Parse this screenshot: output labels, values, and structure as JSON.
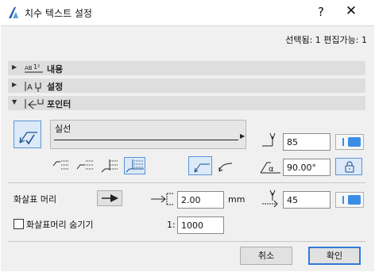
{
  "window": {
    "title": "치수 텍스트 설정",
    "help_label": "?",
    "close_label": "✕"
  },
  "selection_info": "선택됨: 1 편집가능: 1",
  "sections": [
    {
      "label": "내용",
      "expanded": false,
      "icon": "text-content-icon"
    },
    {
      "label": "설정",
      "expanded": false,
      "icon": "text-settings-icon"
    },
    {
      "label": "포인터",
      "expanded": true,
      "icon": "pointer-icon"
    }
  ],
  "pointer": {
    "line_type_label": "실선",
    "pen_value": "85",
    "angle_value": "90.00°",
    "arrowhead_label": "화살표 머리",
    "arrow_size_value": "2.00",
    "arrow_size_unit": "mm",
    "arrow_pen_value": "45",
    "hide_arrowhead_label": "화살표머리 숨기기",
    "hide_arrowhead_checked": false,
    "scale_prefix": "1:",
    "scale_value": "1000",
    "angle_symbol": "α"
  },
  "buttons": {
    "cancel": "취소",
    "ok": "확인"
  },
  "colors": {
    "accent": "#3a8ee6",
    "selected_bg": "#dbe9f8",
    "selected_border": "#5b95d6",
    "section_bg": "#dedede"
  }
}
